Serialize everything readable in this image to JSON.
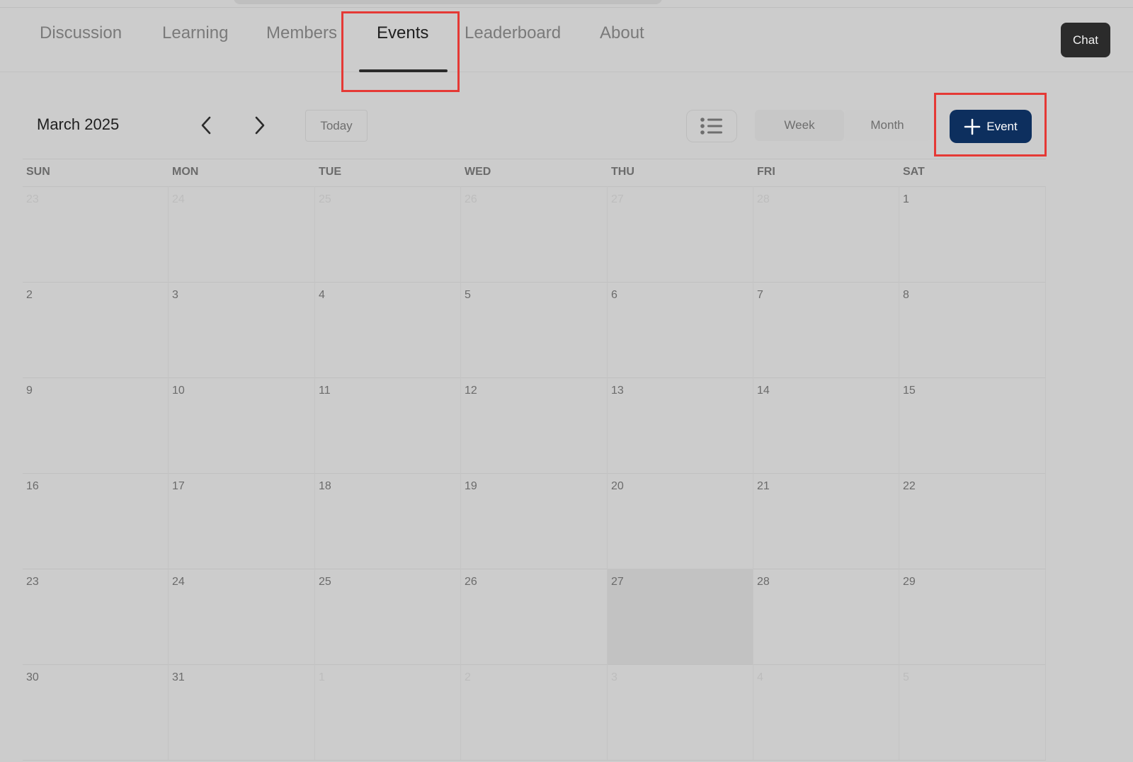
{
  "nav": {
    "tabs": [
      {
        "label": "Discussion",
        "active": false
      },
      {
        "label": "Learning",
        "active": false
      },
      {
        "label": "Members",
        "active": false
      },
      {
        "label": "Events",
        "active": true
      },
      {
        "label": "Leaderboard",
        "active": false
      },
      {
        "label": "About",
        "active": false
      }
    ],
    "chat_label": "Chat"
  },
  "toolbar": {
    "month_title": "March 2025",
    "prev_icon": "chevron-left-icon",
    "next_icon": "chevron-right-icon",
    "today_label": "Today",
    "list_icon": "list-view-icon",
    "week_label": "Week",
    "month_label": "Month",
    "add_event_label": "Event",
    "add_event_icon": "plus-icon"
  },
  "calendar": {
    "weekdays": [
      "SUN",
      "MON",
      "TUE",
      "WED",
      "THU",
      "FRI",
      "SAT"
    ],
    "weeks": [
      [
        {
          "d": "23",
          "out": true
        },
        {
          "d": "24",
          "out": true
        },
        {
          "d": "25",
          "out": true
        },
        {
          "d": "26",
          "out": true
        },
        {
          "d": "27",
          "out": true
        },
        {
          "d": "28",
          "out": true
        },
        {
          "d": "1",
          "out": false
        }
      ],
      [
        {
          "d": "2",
          "out": false
        },
        {
          "d": "3",
          "out": false
        },
        {
          "d": "4",
          "out": false
        },
        {
          "d": "5",
          "out": false
        },
        {
          "d": "6",
          "out": false
        },
        {
          "d": "7",
          "out": false
        },
        {
          "d": "8",
          "out": false
        }
      ],
      [
        {
          "d": "9",
          "out": false
        },
        {
          "d": "10",
          "out": false
        },
        {
          "d": "11",
          "out": false
        },
        {
          "d": "12",
          "out": false
        },
        {
          "d": "13",
          "out": false
        },
        {
          "d": "14",
          "out": false
        },
        {
          "d": "15",
          "out": false
        }
      ],
      [
        {
          "d": "16",
          "out": false
        },
        {
          "d": "17",
          "out": false
        },
        {
          "d": "18",
          "out": false
        },
        {
          "d": "19",
          "out": false
        },
        {
          "d": "20",
          "out": false
        },
        {
          "d": "21",
          "out": false
        },
        {
          "d": "22",
          "out": false
        }
      ],
      [
        {
          "d": "23",
          "out": false
        },
        {
          "d": "24",
          "out": false
        },
        {
          "d": "25",
          "out": false
        },
        {
          "d": "26",
          "out": false
        },
        {
          "d": "27",
          "out": false,
          "today": true
        },
        {
          "d": "28",
          "out": false
        },
        {
          "d": "29",
          "out": false
        }
      ],
      [
        {
          "d": "30",
          "out": false
        },
        {
          "d": "31",
          "out": false
        },
        {
          "d": "1",
          "out": true
        },
        {
          "d": "2",
          "out": true
        },
        {
          "d": "3",
          "out": true
        },
        {
          "d": "4",
          "out": true
        },
        {
          "d": "5",
          "out": true
        }
      ]
    ]
  },
  "colors": {
    "accent": "#0d2f5e",
    "highlight": "#e53935",
    "background": "#cccccc"
  }
}
